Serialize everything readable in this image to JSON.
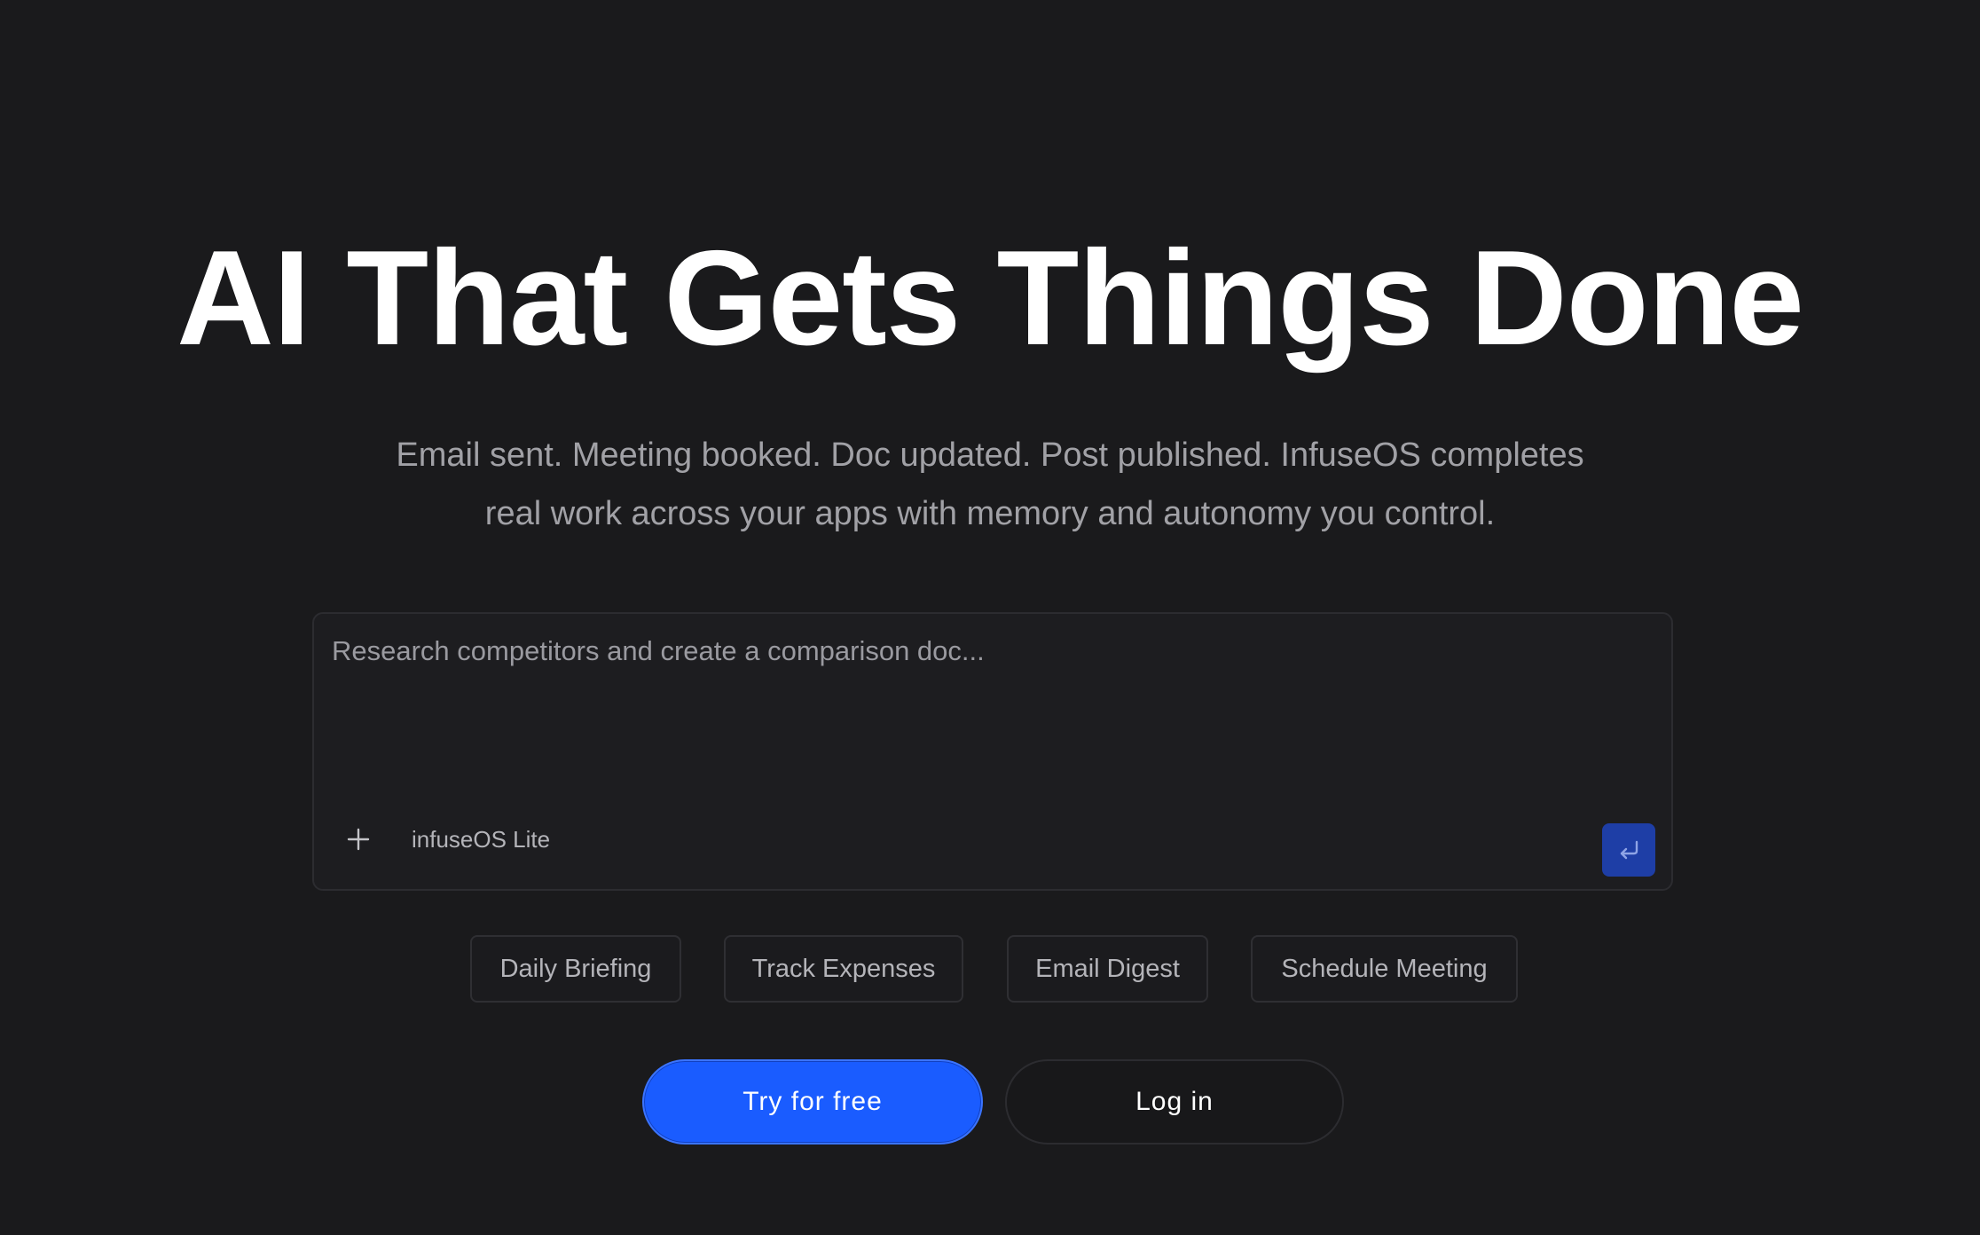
{
  "hero": {
    "title": "AI That Gets Things Done",
    "subtitle": "Email sent. Meeting booked. Doc updated. Post published. InfuseOS completes real work across your apps with memory and autonomy you control."
  },
  "prompt": {
    "placeholder": "Research competitors and create a comparison doc...",
    "value": "",
    "model_label": "infuseOS Lite",
    "attach_icon": "plus-icon",
    "send_icon": "enter-return-icon"
  },
  "suggestions": [
    {
      "label": "Daily Briefing"
    },
    {
      "label": "Track Expenses"
    },
    {
      "label": "Email Digest"
    },
    {
      "label": "Schedule Meeting"
    }
  ],
  "actions": {
    "primary_label": "Try for free",
    "secondary_label": "Log in"
  },
  "colors": {
    "background": "#1a1a1c",
    "accent": "#1a5cff",
    "send_button": "#1e3ea6"
  }
}
